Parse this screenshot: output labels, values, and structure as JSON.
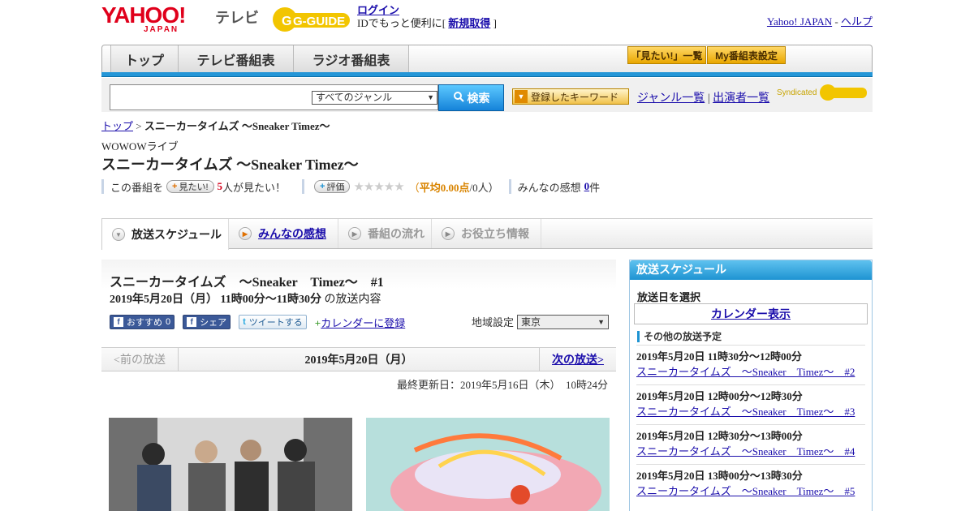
{
  "header": {
    "yahoo_logo": "YAHOO!",
    "yahoo_logo_sub": "JAPAN",
    "tv_label": "テレビ",
    "gguide_logo": "G-GUIDE",
    "login_label": "ログイン",
    "login_prompt": "IDでもっと便利に[",
    "register_label": "新規取得",
    "register_close": "]",
    "yahoo_japan_link": "Yahoo! JAPAN",
    "dash": "-",
    "help_link": "ヘルプ"
  },
  "nav": {
    "tabs": [
      "トップ",
      "テレビ番組表",
      "ラジオ番組表"
    ],
    "want_list_button": "「見たい!」一覧",
    "my_schedule_button": "My番組表設定"
  },
  "search": {
    "query": "",
    "genre_selected": "すべてのジャンル",
    "search_button": "検索",
    "keyword_button": "登録したキーワード",
    "genre_list_link": "ジャンル一覧",
    "divider": "|",
    "performer_list_link": "出演者一覧",
    "syndicated": "Syndicated"
  },
  "breadcrumb": {
    "home": "トップ",
    "separator": ">",
    "current": "スニーカータイムズ ～Sneaker Timez～"
  },
  "program": {
    "channel": "WOWOWライブ",
    "title": "スニーカータイムズ ～Sneaker Timez～",
    "want_prefix": "この番組を",
    "want_button": "見たい!",
    "want_count": "5",
    "want_suffix": "人が見たい！",
    "rate_button": "評価",
    "stars": "★★★★★",
    "rating_open": "（",
    "rating_label": "平均0.00点",
    "rating_people": "/0人）",
    "impressions_label": "みんなの感想",
    "impressions_count": "0",
    "impressions_unit": "件"
  },
  "subtabs": [
    "放送スケジュール",
    "みんなの感想",
    "番組の流れ",
    "お役立ち情報"
  ],
  "episode": {
    "title": "スニーカータイムズ　～Sneaker　Timez～　#1",
    "datetime": "2019年5月20日（月）  11時00分～11時30分",
    "datetime_suffix": "の放送内容",
    "fb_recommend": "おすすめ",
    "fb_recommend_count": "0",
    "fb_share": "シェア",
    "tweet": "ツイートする",
    "calendar_link": "カレンダーに登録",
    "region_label": "地域設定",
    "region_value": "東京"
  },
  "pager": {
    "prev": "<前の放送",
    "current": "2019年5月20日（月）",
    "next": "次の放送>"
  },
  "last_updated": "最終更新日：2019年5月16日（木）　10時24分",
  "sidebar": {
    "title": "放送スケジュール",
    "select_date": "放送日を選択",
    "calendar_button": "カレンダー表示",
    "other_schedules": "その他の放送予定",
    "items": [
      {
        "time": "2019年5月20日  11時30分～12時00分",
        "link": "スニーカータイムズ　～Sneaker　Timez～　#2"
      },
      {
        "time": "2019年5月20日  12時00分～12時30分",
        "link": "スニーカータイムズ　～Sneaker　Timez～　#3"
      },
      {
        "time": "2019年5月20日  12時30分～13時00分",
        "link": "スニーカータイムズ　～Sneaker　Timez～　#4"
      },
      {
        "time": "2019年5月20日  13時00分～13時30分",
        "link": "スニーカータイムズ　～Sneaker　Timez～　#5"
      }
    ]
  },
  "colors": {
    "yahoo_red": "#e0001b",
    "nav_blue": "#2496d7",
    "gold": "#e9a700",
    "link": "#1a0dab"
  }
}
